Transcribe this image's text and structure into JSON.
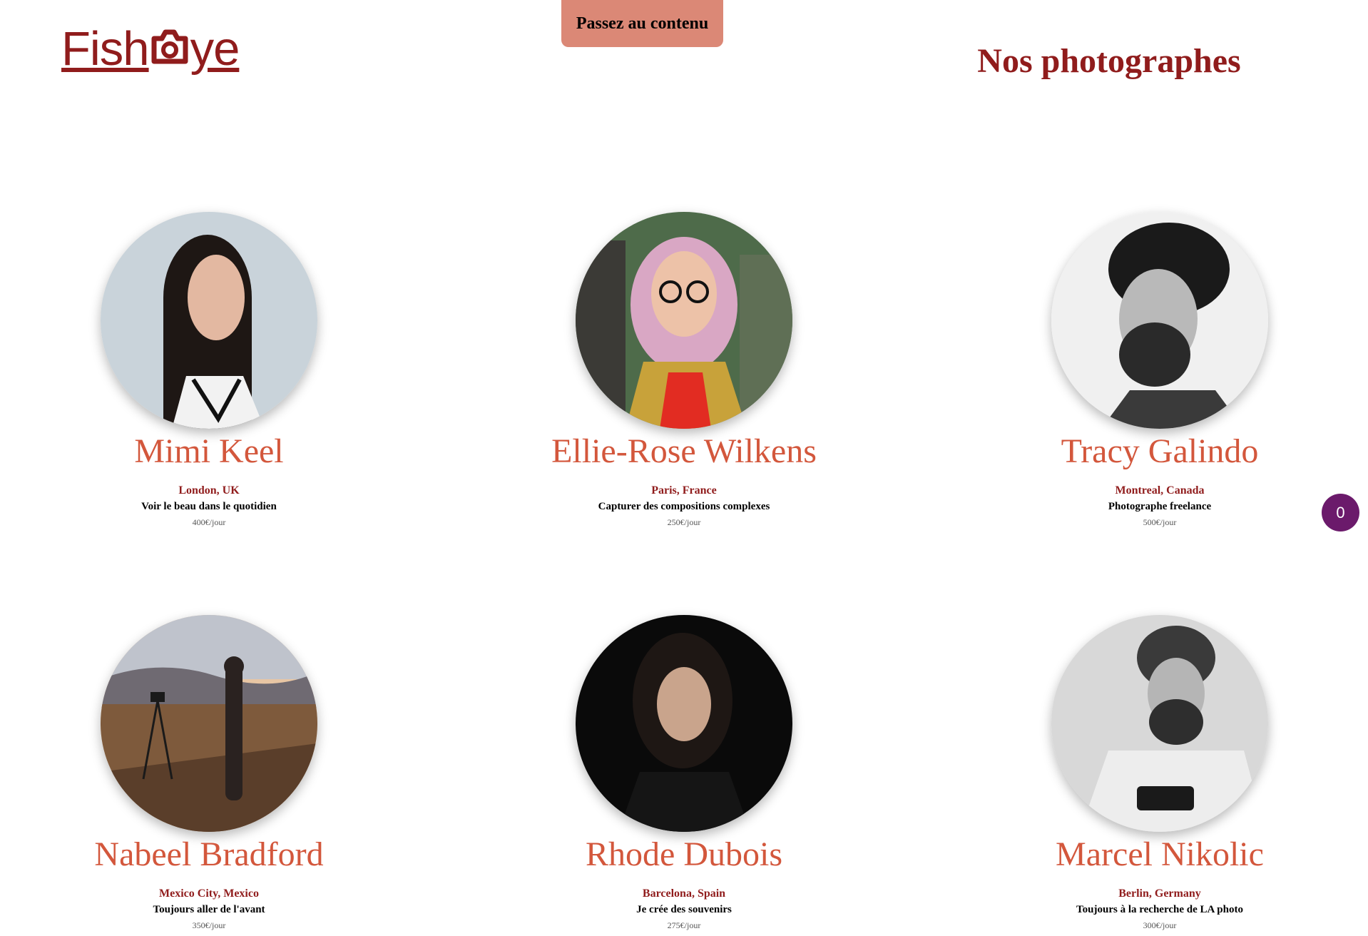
{
  "header": {
    "logo_text_left": "Fish",
    "logo_text_right": "ye",
    "logo_icon": "camera-icon",
    "skip_link_label": "Passez au contenu",
    "page_title": "Nos photographes"
  },
  "colors": {
    "brand_dark_red": "#901C1C",
    "name_orange": "#D3573C",
    "skip_link_bg": "#DB8876",
    "counter_bg": "#6B1A6B"
  },
  "photographers": [
    {
      "name": "Mimi Keel",
      "location": "London, UK",
      "tagline": "Voir le beau dans le quotidien",
      "price": "400€/jour"
    },
    {
      "name": "Ellie-Rose Wilkens",
      "location": "Paris, France",
      "tagline": "Capturer des compositions complexes",
      "price": "250€/jour"
    },
    {
      "name": "Tracy Galindo",
      "location": "Montreal, Canada",
      "tagline": "Photographe freelance",
      "price": "500€/jour"
    },
    {
      "name": "Nabeel Bradford",
      "location": "Mexico City, Mexico",
      "tagline": "Toujours aller de l'avant",
      "price": "350€/jour"
    },
    {
      "name": "Rhode Dubois",
      "location": "Barcelona, Spain",
      "tagline": "Je crée des souvenirs",
      "price": "275€/jour"
    },
    {
      "name": "Marcel Nikolic",
      "location": "Berlin, Germany",
      "tagline": "Toujours à la recherche de LA photo",
      "price": "300€/jour"
    }
  ],
  "counter": {
    "value": "0"
  }
}
